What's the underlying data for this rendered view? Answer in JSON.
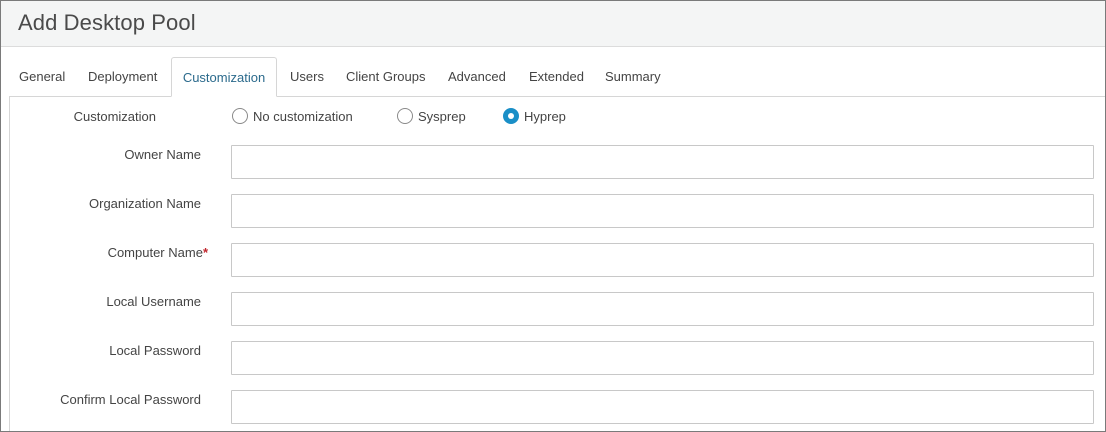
{
  "window": {
    "title": "Add Desktop Pool"
  },
  "tabs": [
    {
      "label": "General",
      "active": false
    },
    {
      "label": "Deployment",
      "active": false
    },
    {
      "label": "Customization",
      "active": true
    },
    {
      "label": "Users",
      "active": false
    },
    {
      "label": "Client Groups",
      "active": false
    },
    {
      "label": "Advanced",
      "active": false
    },
    {
      "label": "Extended",
      "active": false
    },
    {
      "label": "Summary",
      "active": false
    }
  ],
  "customization": {
    "label": "Customization",
    "options": [
      {
        "label": "No customization",
        "selected": false
      },
      {
        "label": "Sysprep",
        "selected": false
      },
      {
        "label": "Hyprep",
        "selected": true
      }
    ]
  },
  "fields": {
    "owner_name": {
      "label": "Owner Name",
      "value": "",
      "required": false
    },
    "organization_name": {
      "label": "Organization Name",
      "value": "",
      "required": false
    },
    "computer_name": {
      "label": "Computer Name",
      "value": "",
      "required": true,
      "required_mark": "*"
    },
    "local_username": {
      "label": "Local Username",
      "value": "",
      "required": false
    },
    "local_password": {
      "label": "Local Password",
      "value": "",
      "required": false
    },
    "confirm_local_password": {
      "label": "Confirm Local Password",
      "value": "",
      "required": false
    }
  },
  "colors": {
    "accent": "#1a8fc7",
    "active_tab_text": "#2b6a8c",
    "required": "#c0262d"
  }
}
